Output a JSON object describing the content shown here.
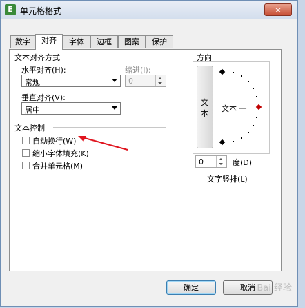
{
  "window": {
    "title": "单元格格式",
    "app_icon": "E",
    "close_glyph": "✕"
  },
  "tabs": [
    {
      "label": "数字"
    },
    {
      "label": "对齐"
    },
    {
      "label": "字体"
    },
    {
      "label": "边框"
    },
    {
      "label": "图案"
    },
    {
      "label": "保护"
    }
  ],
  "text_alignment": {
    "heading": "文本对齐方式",
    "horizontal_label": "水平对齐(H):",
    "horizontal_value": "常规",
    "indent_label": "缩进(I):",
    "indent_value": "0",
    "vertical_label": "垂直对齐(V):",
    "vertical_value": "居中"
  },
  "text_control": {
    "heading": "文本控制",
    "wrap_text": "自动换行(W)",
    "shrink_to_fit": "缩小字体填充(K)",
    "merge_cells": "合并单元格(M)"
  },
  "orientation": {
    "heading": "方向",
    "vertical_text_1": "文",
    "vertical_text_2": "本",
    "dial_text": "文本 一",
    "degree_value": "0",
    "degree_label": "度(D)",
    "vertical_checkbox": "文字竖排(L)"
  },
  "buttons": {
    "ok": "确定",
    "cancel": "取消"
  },
  "watermark": "Bai 经验",
  "colors": {
    "arrow": "#e0141e",
    "accent_diamond": "#c00000"
  }
}
